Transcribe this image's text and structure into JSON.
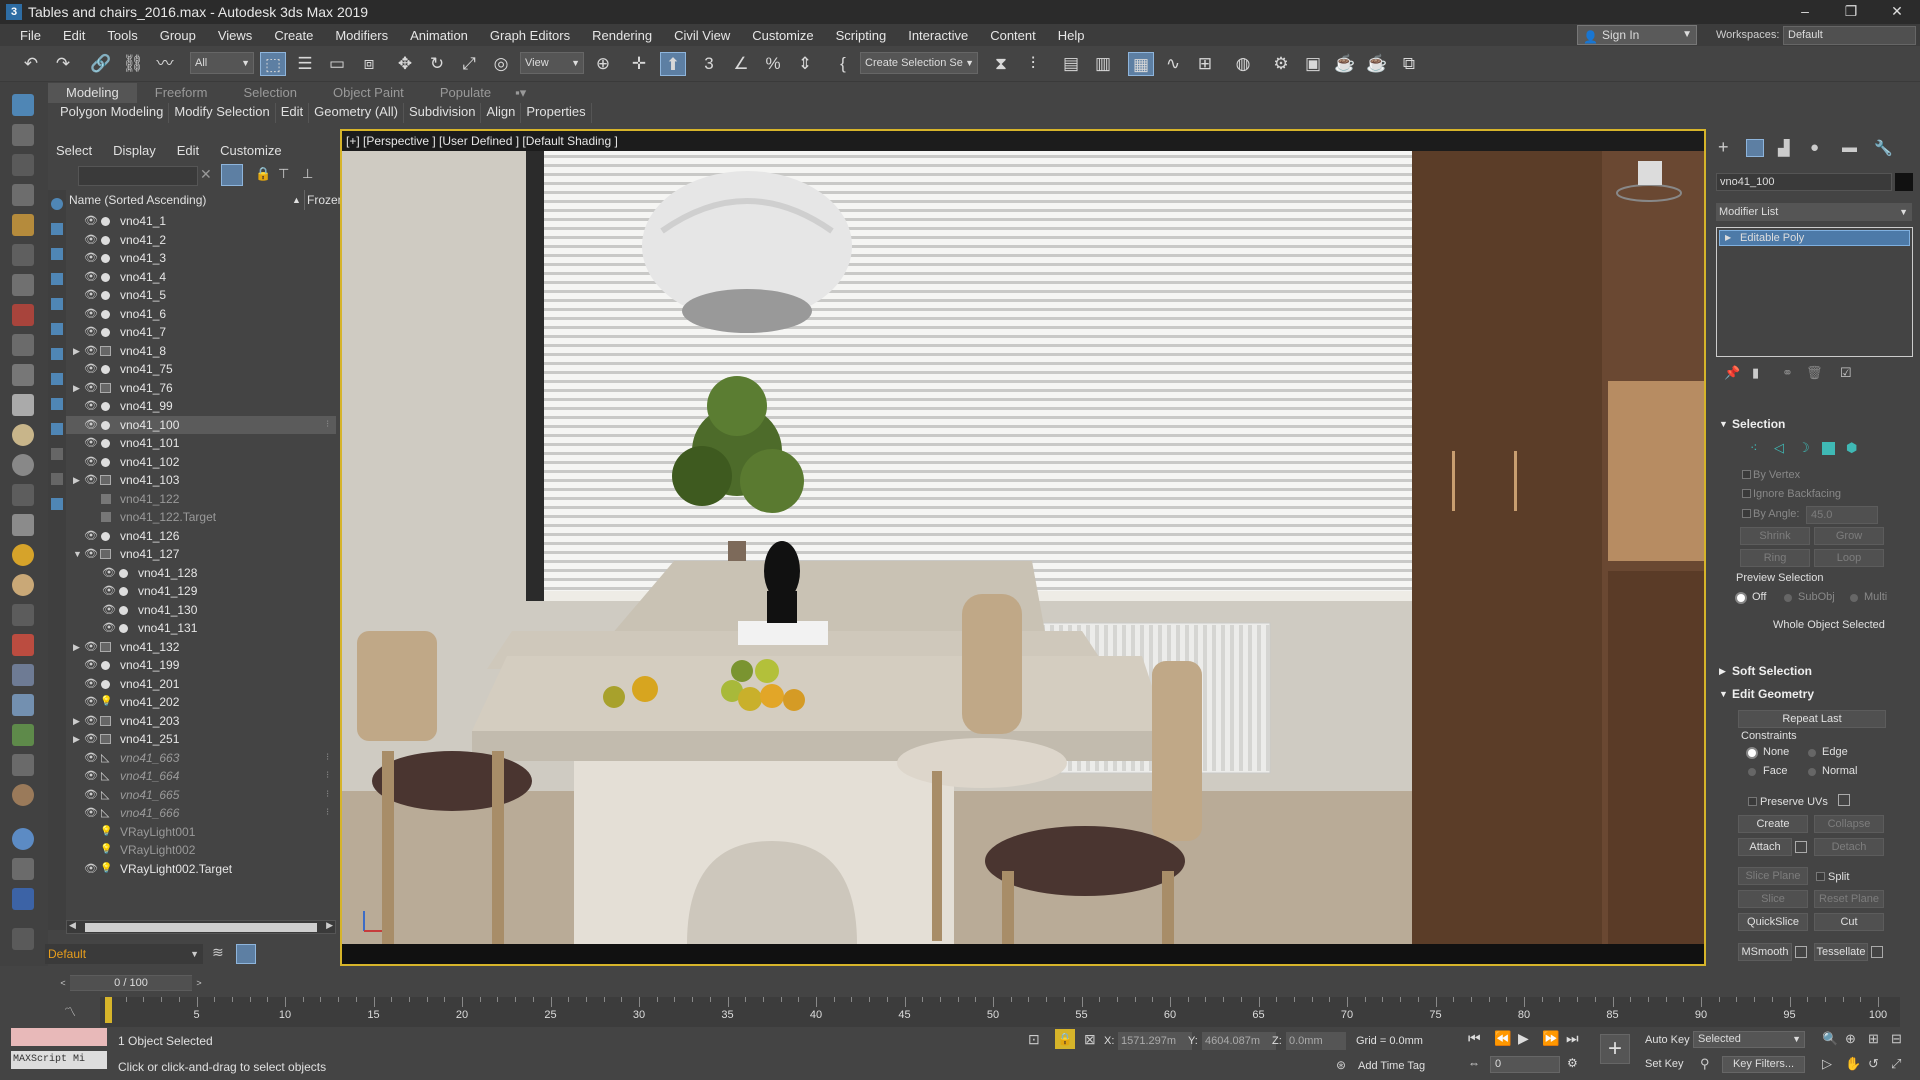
{
  "window": {
    "title": "Tables and chairs_2016.max - Autodesk 3ds Max 2019",
    "app_icon": "3",
    "min": "–",
    "max": "❐",
    "close": "✕"
  },
  "menu": [
    "File",
    "Edit",
    "Tools",
    "Group",
    "Views",
    "Create",
    "Modifiers",
    "Animation",
    "Graph Editors",
    "Rendering",
    "Civil View",
    "Customize",
    "Scripting",
    "Interactive",
    "Content",
    "Help"
  ],
  "signin": {
    "label": "Sign In"
  },
  "workspaces": {
    "label": "Workspaces:",
    "value": "Default"
  },
  "toolbar": {
    "filter": "All",
    "refcoord": "View",
    "selset": "Create Selection Se"
  },
  "ribbon": {
    "tabs": [
      "Modeling",
      "Freeform",
      "Selection",
      "Object Paint",
      "Populate"
    ],
    "subtabs": [
      "Polygon Modeling",
      "Modify Selection",
      "Edit",
      "Geometry (All)",
      "Subdivision",
      "Align",
      "Properties"
    ]
  },
  "scene_explorer": {
    "tabs": [
      "Select",
      "Display",
      "Edit",
      "Customize"
    ],
    "col_name": "Name (Sorted Ascending)",
    "col_frozen": "Frozen",
    "rows": [
      {
        "name": "vno41_1",
        "t": "o"
      },
      {
        "name": "vno41_2",
        "t": "o"
      },
      {
        "name": "vno41_3",
        "t": "o"
      },
      {
        "name": "vno41_4",
        "t": "o"
      },
      {
        "name": "vno41_5",
        "t": "o"
      },
      {
        "name": "vno41_6",
        "t": "o"
      },
      {
        "name": "vno41_7",
        "t": "o"
      },
      {
        "name": "vno41_8",
        "t": "g",
        "exp": "▶"
      },
      {
        "name": "vno41_75",
        "t": "o"
      },
      {
        "name": "vno41_76",
        "t": "g",
        "exp": "▶"
      },
      {
        "name": "vno41_99",
        "t": "o"
      },
      {
        "name": "vno41_100",
        "t": "o",
        "sel": true
      },
      {
        "name": "vno41_101",
        "t": "o"
      },
      {
        "name": "vno41_102",
        "t": "o"
      },
      {
        "name": "vno41_103",
        "t": "g",
        "exp": "▶"
      },
      {
        "name": "vno41_122",
        "t": "c",
        "dim": true
      },
      {
        "name": "vno41_122.Target",
        "t": "c",
        "dim": true
      },
      {
        "name": "vno41_126",
        "t": "o"
      },
      {
        "name": "vno41_127",
        "t": "g",
        "exp": "▼"
      },
      {
        "name": "vno41_128",
        "t": "o",
        "ind": true
      },
      {
        "name": "vno41_129",
        "t": "o",
        "ind": true
      },
      {
        "name": "vno41_130",
        "t": "o",
        "ind": true
      },
      {
        "name": "vno41_131",
        "t": "o",
        "ind": true
      },
      {
        "name": "vno41_132",
        "t": "g",
        "exp": "▶"
      },
      {
        "name": "vno41_199",
        "t": "o"
      },
      {
        "name": "vno41_201",
        "t": "o"
      },
      {
        "name": "vno41_202",
        "t": "l"
      },
      {
        "name": "vno41_203",
        "t": "g",
        "exp": "▶"
      },
      {
        "name": "vno41_251",
        "t": "g",
        "exp": "▶"
      },
      {
        "name": "vno41_663",
        "t": "s",
        "it": true
      },
      {
        "name": "vno41_664",
        "t": "s",
        "it": true
      },
      {
        "name": "vno41_665",
        "t": "s",
        "it": true
      },
      {
        "name": "vno41_666",
        "t": "s",
        "it": true
      },
      {
        "name": "VRayLight001",
        "t": "l",
        "dim": true
      },
      {
        "name": "VRayLight002",
        "t": "l",
        "dim": true
      },
      {
        "name": "VRayLight002.Target",
        "t": "l"
      }
    ],
    "layer": "Default"
  },
  "viewport": {
    "label": "[+] [Perspective ] [User Defined ] [Default Shading ]"
  },
  "command_panel": {
    "object_name": "vno41_100",
    "modifier_list": "Modifier List",
    "stack_item": "Editable Poly",
    "selection": {
      "title": "Selection",
      "by_vertex": "By Vertex",
      "ignore_backfacing": "Ignore Backfacing",
      "by_angle": "By Angle:",
      "angle": "45.0",
      "shrink": "Shrink",
      "grow": "Grow",
      "ring": "Ring",
      "loop": "Loop",
      "preview": "Preview Selection",
      "off": "Off",
      "subobj": "SubObj",
      "multi": "Multi",
      "whole": "Whole Object Selected"
    },
    "soft_selection": "Soft Selection",
    "edit_geometry": {
      "title": "Edit Geometry",
      "repeat_last": "Repeat Last",
      "constraints": "Constraints",
      "none": "None",
      "edge": "Edge",
      "face": "Face",
      "normal": "Normal",
      "preserve_uvs": "Preserve UVs",
      "create": "Create",
      "collapse": "Collapse",
      "attach": "Attach",
      "detach": "Detach",
      "slice_plane": "Slice Plane",
      "split": "Split",
      "slice": "Slice",
      "reset_plane": "Reset Plane",
      "quickslice": "QuickSlice",
      "cut": "Cut",
      "msmooth": "MSmooth",
      "tessellate": "Tessellate"
    }
  },
  "timeline": {
    "frame": "0 / 100",
    "ticks": [
      "0",
      "5",
      "10",
      "15",
      "20",
      "25",
      "30",
      "35",
      "40",
      "45",
      "50",
      "55",
      "60",
      "65",
      "70",
      "75",
      "80",
      "85",
      "90",
      "95",
      "100"
    ]
  },
  "status": {
    "selected": "1 Object Selected",
    "prompt": "Click or click-and-drag to select objects",
    "x": "1571.297m",
    "y": "4604.087m",
    "z": "0.0mm",
    "grid": "Grid = 0.0mm",
    "add_time_tag": "Add Time Tag",
    "auto_key": "Auto Key",
    "set_key": "Set Key",
    "key_mode": "Selected",
    "key_filters": "Key Filters...",
    "frame": "0",
    "maxscript": "MAXScript Mi"
  }
}
